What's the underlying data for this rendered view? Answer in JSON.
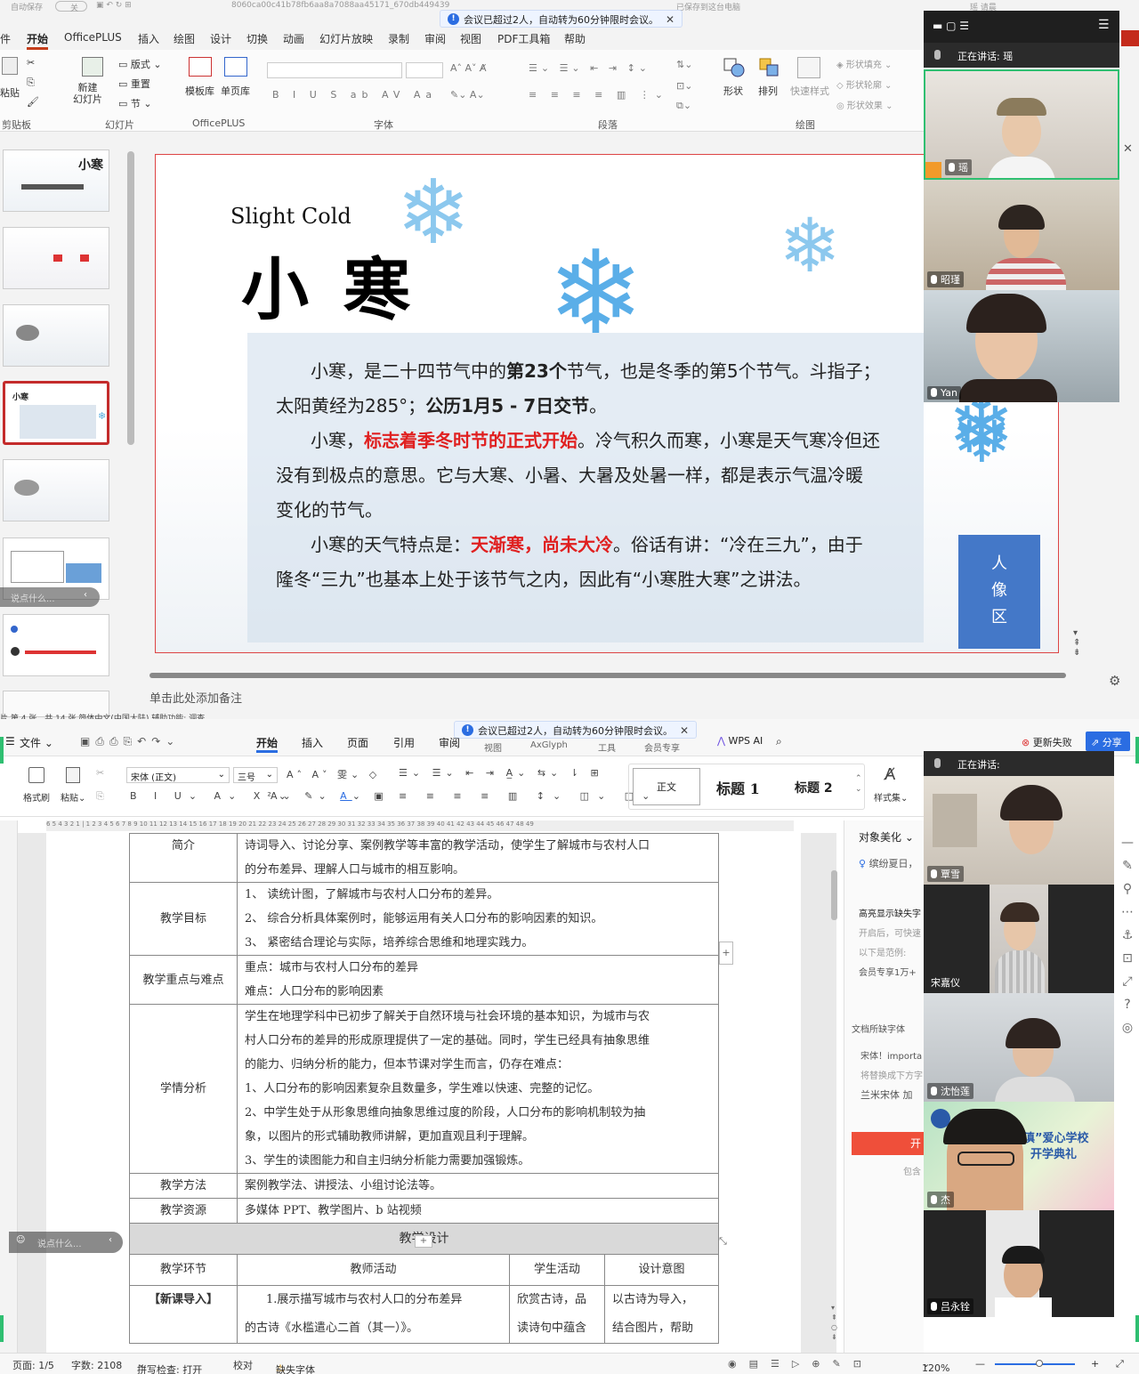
{
  "ppt": {
    "title_fragments": {
      "autosave": "自动保存",
      "autosave_state": "关",
      "filename": "8060ca00c41b78fb6aa8a7088aa45171_670db449439",
      "saved": "已保存到这台电脑",
      "user": "瑶 请晨"
    },
    "tabs": [
      "件",
      "开始",
      "OfficePLUS",
      "插入",
      "绘图",
      "设计",
      "切换",
      "动画",
      "幻灯片放映",
      "录制",
      "审阅",
      "视图",
      "PDF工具箱",
      "帮助"
    ],
    "ribbon": {
      "paste": "粘贴",
      "new_slide": "新建\n幻灯片",
      "layout": "版式",
      "reset": "重置",
      "section": "节",
      "template": "模板库",
      "single": "单页库",
      "shape": "形状",
      "arrange": "排列",
      "quick_style": "快速样式",
      "shape_fill": "形状填充",
      "shape_outline": "形状轮廓",
      "shape_effect": "形状效果",
      "groups": {
        "clipboard": "剪贴板",
        "slides": "幻灯片",
        "officeplus": "OfficePLUS",
        "font": "字体",
        "paragraph": "段落",
        "drawing": "绘图"
      }
    },
    "notification": "会议已超过2人，自动转为60分钟限时会议。",
    "slide": {
      "en_title": "Slight Cold",
      "cn_title": "小 寒",
      "p1a": "小寒，是二十四节气中的",
      "p1b": "第23个",
      "p1c": "节气，也是冬季的第5个节气。斗指子；",
      "p2a": "太阳黄经为285°；",
      "p2b": "公历1月5 - 7日交节",
      "p2c": "。",
      "p3a": "小寒，",
      "p3b": "标志着季冬时节的正式开始",
      "p3c": "。冷气积久而寒，小寒是天气寒冷但还",
      "p4": "没有到极点的意思。它与大寒、小暑、大暑及处暑一样，都是表示气温冷暖",
      "p5": "变化的节气。",
      "p6a": "小寒的天气特点是：",
      "p6b": "天渐寒，尚未大冷",
      "p6c": "。俗话有讲：“冷在三九”，由于",
      "p7": "隆冬“三九”也基本上处于该节气之内，因此有“小寒胜大寒”之讲法。",
      "portrait": "人\n像\n区"
    },
    "notes_placeholder": "单击此处添加备注",
    "status_partial": "片 第 4 张，共 14 张    简体中文(中国大陆)    辅助功能: 调查",
    "chat_placeholder": "说点什么...",
    "meeting": {
      "speaking_label": "正在讲话:",
      "speaking_name": "瑶",
      "participants": [
        "瑶",
        "昭瑾",
        "Yan"
      ]
    }
  },
  "wps": {
    "notification": "会议已超过2人，自动转为60分钟限时会议。",
    "tabs": [
      "文件",
      "开始",
      "插入",
      "页面",
      "引用",
      "审阅",
      "视图",
      "AxGlyph",
      "工具",
      "会员专享"
    ],
    "wps_ai": "WPS AI",
    "update_failed": "更新失败",
    "share": "分享",
    "ribbon": {
      "format_brush": "格式刷",
      "paste": "粘贴",
      "font": "宋体 (正文)",
      "size": "三号",
      "style_normal": "正文",
      "heading1": "标题 1",
      "heading2": "标题 2",
      "style_set": "样式集"
    },
    "ruler_text": "6 5 4 3 2 1 | 1 2 3 4 5 6 7 8 9 10 11 12 13 14 15 16 17 18 19 20 21 22 23 24 25 26 27 28 29 30 31 32 33 34 35 36 37 38 39 40 41 42 43 44 45 46 47 48 49",
    "table": {
      "intro_label": "简介",
      "intro": [
        "诗词导入、讨论分享、案例教学等丰富的教学活动，使学生了解城市与农村人口",
        "的分布差异、理解人口与城市的相互影响。"
      ],
      "goal_label": "教学目标",
      "goals": [
        "1、 读统计图，了解城市与农村人口分布的差异。",
        "2、 综合分析具体案例时，能够运用有关人口分布的影响因素的知识。",
        "3、 紧密结合理论与实际，培养综合思维和地理实践力。"
      ],
      "key_label": "教学重点与难点",
      "keys": [
        "重点：城市与农村人口分布的差异",
        "难点：人口分布的影响因素"
      ],
      "analysis_label": "学情分析",
      "analysis": [
        "学生在地理学科中已初步了解关于自然环境与社会环境的基本知识，为城市与农",
        "村人口分布的差异的形成原理提供了一定的基础。同时，学生已经具有抽象思维",
        "的能力、归纳分析的能力，但本节课对学生而言，仍存在难点：",
        "1、人口分布的影响因素复杂且数量多，学生难以快速、完整的记忆。",
        "2、中学生处于从形象思维向抽象思维过度的阶段，人口分布的影响机制较为抽",
        "象，以图片的形式辅助教师讲解，更加直观且利于理解。",
        "3、学生的读图能力和自主归纳分析能力需要加强锻炼。"
      ],
      "method_label": "教学方法",
      "method": "案例教学法、讲授法、小组讨论法等。",
      "resource_label": "教学资源",
      "resource": "多媒体 PPT、教学图片、b 站视频",
      "design_header": "教学设计",
      "col_headers": [
        "教学环节",
        "教师活动",
        "学生活动",
        "设计意图"
      ],
      "row1": {
        "stage": "【新课导入】",
        "teacher": [
          "1.展示描写城市与农村人口的分布差异",
          "的古诗《水槛遣心二首（其一）》。"
        ],
        "student": [
          "欣赏古诗，品",
          "读诗句中蕴含"
        ],
        "intent": [
          "以古诗为导入，",
          "结合图片，帮助"
        ]
      }
    },
    "right_panel": {
      "beautify": "对象美化",
      "tip": "缤纷夏日，",
      "highlight_title": "高亮显示缺失字",
      "desc1": "开启后，可快速",
      "desc2": "以下是范例:",
      "sample": "会员专享1万+",
      "missing_title": "文档所缺字体",
      "font1": "宋体！importa",
      "font2": "将替换成下方字",
      "font3": "兰米宋体 加",
      "btn": "开",
      "incl": "包含"
    },
    "status": {
      "page": "页面: 1/5",
      "words": "字数: 2108",
      "spell": "拼写检查: 打开",
      "proof": "校对",
      "missing": "缺失字体",
      "zoom": "120%"
    },
    "meeting": {
      "speaking_label": "正在讲话:",
      "participants": [
        "覃雪",
        "宋嘉仪",
        "沈怡莲",
        "杰",
        "吕永铨"
      ],
      "banner_text1": "滇”爱心学校",
      "banner_text2": "开学典礼"
    }
  }
}
